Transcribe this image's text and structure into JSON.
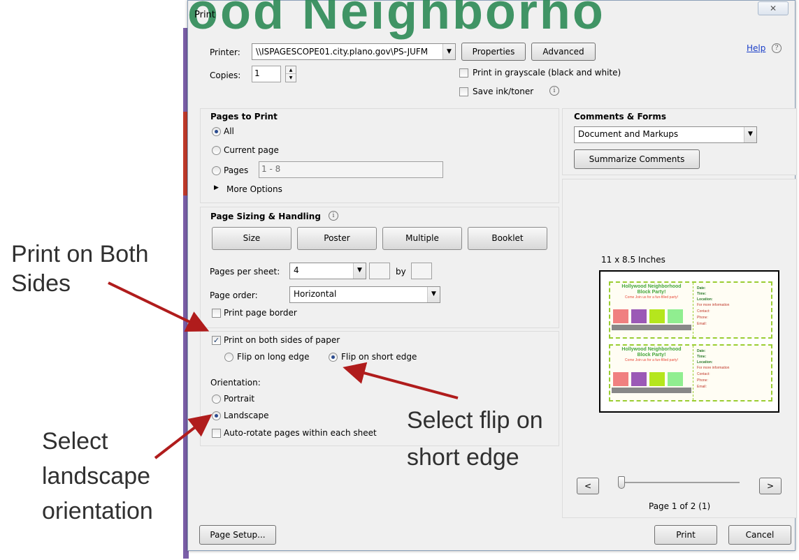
{
  "background": {
    "banner_text": "ood Neighborho"
  },
  "dialog": {
    "title": "Print",
    "close_glyph": "✕",
    "help_label": "Help",
    "help_icon": "?"
  },
  "printer": {
    "label": "Printer:",
    "value": "\\\\ISPAGESCOPE01.city.plano.gov\\PS-JUFM",
    "properties_label": "Properties",
    "advanced_label": "Advanced",
    "copies_label": "Copies:",
    "copies_value": "1",
    "grayscale_label": "Print in grayscale (black and white)",
    "grayscale_checked": false,
    "save_ink_label": "Save ink/toner",
    "save_ink_checked": false
  },
  "pages_to_print": {
    "title": "Pages to Print",
    "all_label": "All",
    "current_label": "Current page",
    "pages_label": "Pages",
    "pages_value": "1 - 8",
    "more_options_label": "More Options",
    "selected": "All"
  },
  "sizing": {
    "title": "Page Sizing & Handling",
    "tabs": [
      "Size",
      "Poster",
      "Multiple",
      "Booklet"
    ],
    "pages_per_sheet_label": "Pages per sheet:",
    "pages_per_sheet_value": "4",
    "by_label": "by",
    "page_order_label": "Page order:",
    "page_order_value": "Horizontal",
    "print_border_label": "Print page border",
    "print_border_checked": false,
    "both_sides_label": "Print on both sides of paper",
    "both_sides_checked": true,
    "flip_long_label": "Flip on long edge",
    "flip_short_label": "Flip on short edge",
    "flip_selected": "Flip on short edge",
    "orientation_label": "Orientation:",
    "portrait_label": "Portrait",
    "landscape_label": "Landscape",
    "orientation_selected": "Landscape",
    "auto_rotate_label": "Auto-rotate pages within each sheet",
    "auto_rotate_checked": false
  },
  "comments": {
    "title": "Comments & Forms",
    "value": "Document and Markups",
    "summarize_label": "Summarize Comments"
  },
  "preview": {
    "paper_size": "11 x 8.5 Inches",
    "card_title_1": "Hollywood Neighborhood",
    "card_title_2": "Block Party!",
    "card_sub": "Come Join us for a fun-filled party!",
    "date_label": "Date:",
    "time_label": "Time:",
    "location_label": "Location:",
    "info_lines": [
      "For more information",
      "Contact:",
      "Phone:",
      "Email:"
    ],
    "prev_label": "<",
    "next_label": ">",
    "page_status": "Page 1 of 2 (1)",
    "page_fraction": 0
  },
  "footer": {
    "page_setup_label": "Page Setup...",
    "print_label": "Print",
    "cancel_label": "Cancel"
  },
  "annotations": {
    "both_sides_1": "Print on Both",
    "both_sides_2": "Sides",
    "flip_1": "Select flip on",
    "flip_2": "short edge",
    "landscape_1": "Select",
    "landscape_2": "landscape",
    "landscape_3": "orientation"
  },
  "colors": {
    "arrow": "#b01c1c",
    "link": "#1a3ec8",
    "banner": "#2e8b57"
  }
}
